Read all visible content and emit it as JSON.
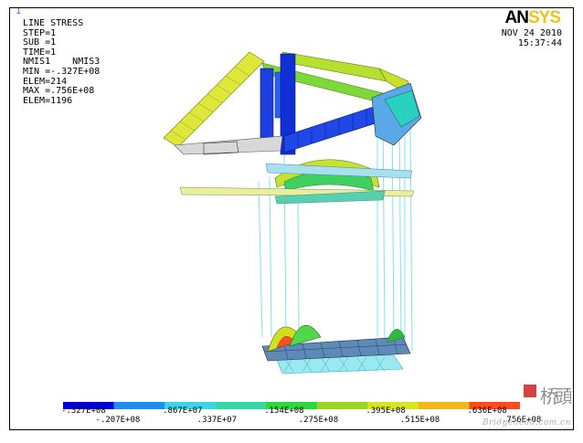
{
  "window_number": "1",
  "title": "LINE STRESS",
  "info_lines": [
    "STEP=1",
    "SUB =1",
    "TIME=1",
    "NMIS1    NMIS3",
    "MIN =-.327E+08",
    "ELEM=214",
    "MAX =.756E+08",
    "ELEM=1196"
  ],
  "logo": {
    "prefix": "AN",
    "suffix": "SYS"
  },
  "date": "NOV 24 2010",
  "time": "15:37:44",
  "legend": {
    "colors": [
      "#0000d6",
      "#1e8ef0",
      "#38d6e8",
      "#33d9a3",
      "#2ad93a",
      "#9ad620",
      "#d7e61a",
      "#f0b818",
      "#ff4a1a"
    ],
    "top_labels": [
      ".327E+08",
      ".867E+07",
      ".154E+08",
      ".395E+08",
      ".636E+08"
    ],
    "top_prefix_first": "-",
    "bottom_labels": [
      "-.207E+08",
      ".337E+07",
      ".275E+08",
      ".515E+08",
      ".756E+08"
    ]
  },
  "watermark": {
    "url": "Bridgehead.com.cn"
  }
}
